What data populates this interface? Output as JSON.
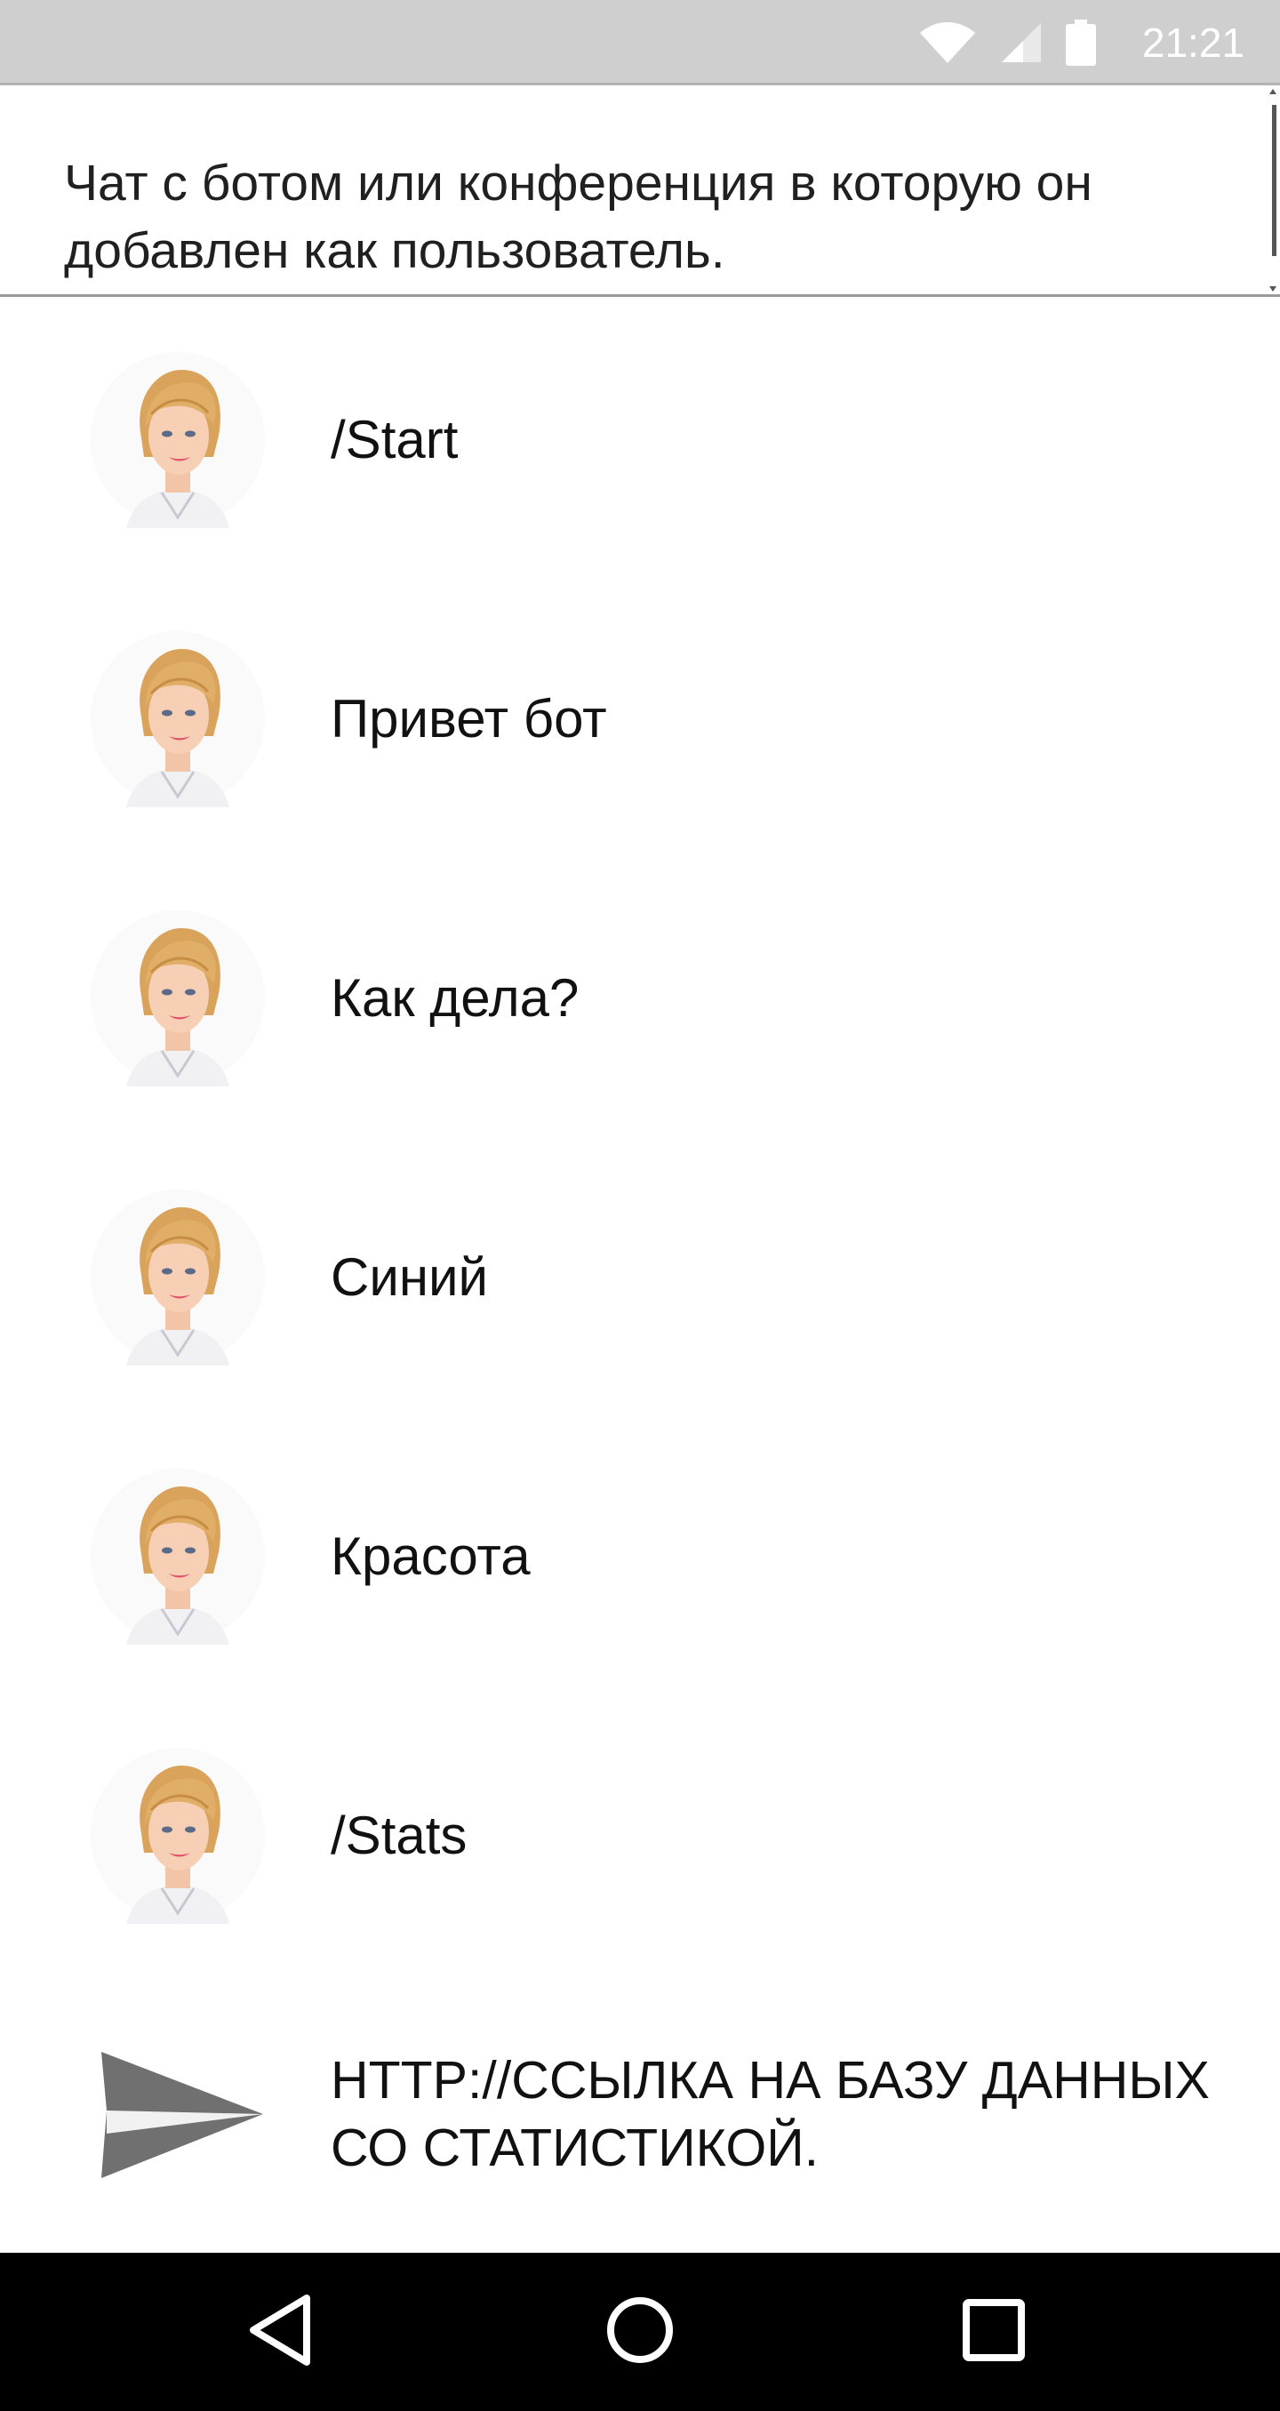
{
  "status_bar": {
    "time": "21:21",
    "icons": [
      "wifi-icon",
      "signal-icon",
      "battery-icon"
    ]
  },
  "header": {
    "text": "Чат с ботом или конференция в которую он добавлен как пользователь."
  },
  "messages": [
    {
      "text": "/Start",
      "avatar": "user-avatar"
    },
    {
      "text": "Привет бот",
      "avatar": "user-avatar"
    },
    {
      "text": "Как дела?",
      "avatar": "user-avatar"
    },
    {
      "text": "Синий",
      "avatar": "user-avatar"
    },
    {
      "text": "Красота",
      "avatar": "user-avatar"
    },
    {
      "text": "/Stats",
      "avatar": "user-avatar"
    }
  ],
  "bot_reply": {
    "icon": "send-icon",
    "text": "HTTP://ССЫЛКА НА БАЗУ ДАННЫХ СО СТАТИСТИКОЙ."
  },
  "nav_bar": {
    "icons": [
      "back-icon",
      "home-icon",
      "recents-icon"
    ]
  },
  "colors": {
    "status_bar_bg": "#cfcfcf",
    "nav_bar_bg": "#000000",
    "send_icon": "#707070",
    "text": "#111111"
  }
}
